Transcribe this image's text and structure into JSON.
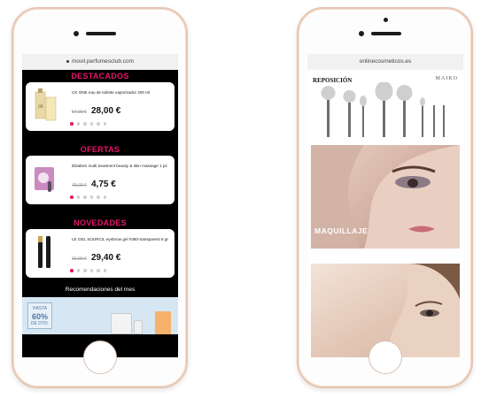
{
  "left_phone": {
    "url": "movil.perfumesclub.com",
    "sections": [
      {
        "title": "DESTACADOS",
        "product_name": "CK ONE eau de toilette vaporizador 200 ml",
        "old_price": "57,00 €",
        "price": "28,00 €"
      },
      {
        "title": "OFERTAS",
        "product_name": "iDitalism multi treatment beauty & skin massage 1 pz",
        "old_price": "79,00 €",
        "price": "4,75 €"
      },
      {
        "title": "NOVEDADES",
        "product_name": "LE GEL SOURCIL eyebrow gel #350-transparent 6 gr",
        "old_price": "32,00 €",
        "price": "29,40 €"
      }
    ],
    "recommendations_label": "Recomendaciones del mes",
    "banner_badge_top": "HASTA",
    "banner_badge_value": "60%",
    "banner_badge_bottom": "DE DTO."
  },
  "right_phone": {
    "url": "onlinecosmeticos.es",
    "brushes_label": "REPOSICIÓN",
    "brand": "MAIKO",
    "makeup_label": "MAQUILLAJE"
  },
  "colors": {
    "accent_pink": "#e6166b",
    "phone_frame": "#e7c5b0"
  }
}
